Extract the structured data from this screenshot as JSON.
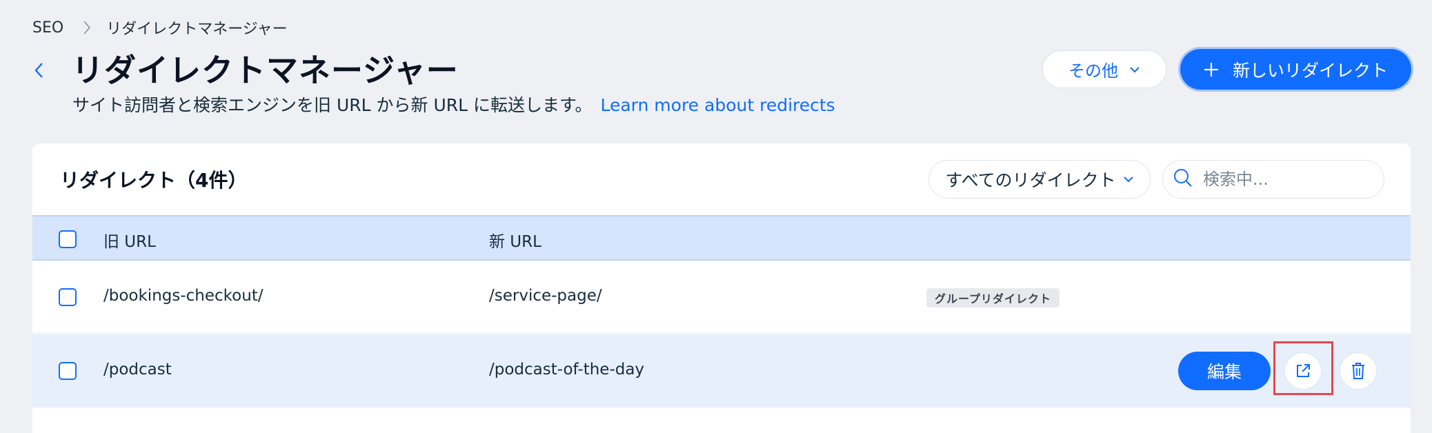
{
  "breadcrumb": {
    "root": "SEO",
    "current": "リダイレクトマネージャー"
  },
  "header": {
    "title": "リダイレクトマネージャー",
    "subtitle": "サイト訪問者と検索エンジンを旧 URL から新 URL に転送します。",
    "learn_more": "Learn more about redirects",
    "other_button": "その他",
    "new_button": "新しいリダイレクト"
  },
  "table": {
    "title": "リダイレクト（4件）",
    "filter_value": "すべてのリダイレクト",
    "search_placeholder": "検索中...",
    "columns": {
      "old_url": "旧 URL",
      "new_url": "新 URL"
    },
    "rows": [
      {
        "old_url": "/bookings-checkout/",
        "new_url": "/service-page/",
        "badge": "グループリダイレクト"
      },
      {
        "old_url": "/podcast",
        "new_url": "/podcast-of-the-day",
        "edit_label": "編集"
      }
    ]
  },
  "colors": {
    "accent": "#116dff",
    "background": "#eff0f4",
    "header_row": "#d6e4fc",
    "hover_row": "#e8effc",
    "highlight": "#e5484d"
  }
}
